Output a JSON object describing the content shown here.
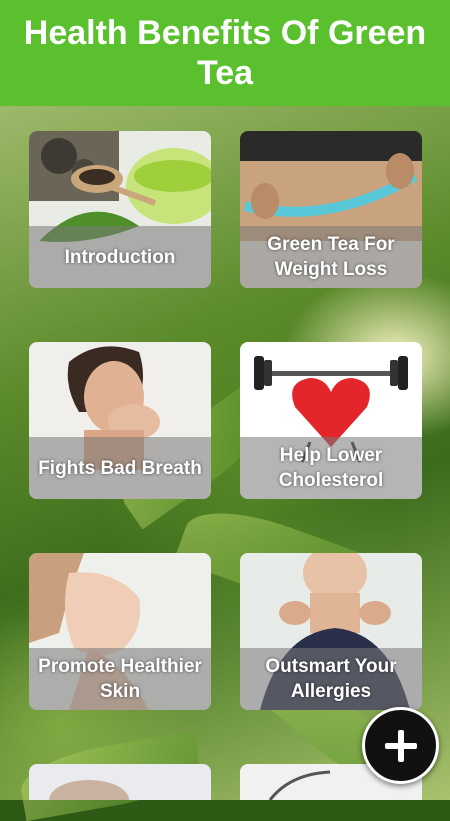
{
  "header": {
    "title": "Health Benefits Of Green Tea"
  },
  "cards": [
    {
      "label": "Introduction",
      "photo": "green-tea-cup-photo"
    },
    {
      "label": "Green Tea For Weight Loss",
      "photo": "measuring-tape-waist-photo"
    },
    {
      "label": "Fights Bad Breath",
      "photo": "bad-breath-woman-photo"
    },
    {
      "label": "Help Lower Cholesterol",
      "photo": "heart-lifting-weights-photo"
    },
    {
      "label": "Promote Healthier Skin",
      "photo": "healthy-skin-woman-photo"
    },
    {
      "label": "Outsmart Your Allergies",
      "photo": "allergy-woman-photo"
    }
  ],
  "fab": {
    "icon": "plus-icon"
  },
  "colors": {
    "header": "#5ac02d",
    "fab": "#111111",
    "caption_overlay": "rgba(120,120,120,0.55)"
  }
}
